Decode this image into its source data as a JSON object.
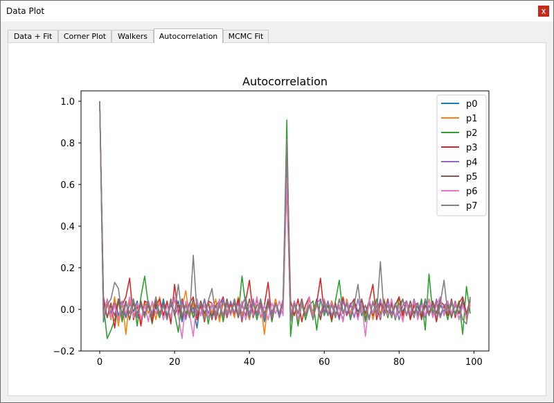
{
  "window": {
    "title": "Data Plot",
    "close_glyph": "x",
    "close_icon": "close-icon"
  },
  "tabs": [
    {
      "label": "Data + Fit",
      "active": false
    },
    {
      "label": "Corner Plot",
      "active": false
    },
    {
      "label": "Walkers",
      "active": false
    },
    {
      "label": "Autocorrelation",
      "active": true
    },
    {
      "label": "MCMC Fit",
      "active": false
    }
  ],
  "chart_data": {
    "type": "line",
    "title": "Autocorrelation",
    "xlabel": "",
    "ylabel": "",
    "xlim": [
      -5,
      104
    ],
    "ylim": [
      -0.2,
      1.05
    ],
    "xticks": [
      0,
      20,
      40,
      60,
      80,
      100
    ],
    "yticks": [
      -0.2,
      0.0,
      0.2,
      0.4,
      0.6,
      0.8,
      1.0
    ],
    "xtick_labels": [
      "0",
      "20",
      "40",
      "60",
      "80",
      "100"
    ],
    "ytick_labels": [
      "−0.2",
      "0.0",
      "0.2",
      "0.4",
      "0.6",
      "0.8",
      "1.0"
    ],
    "grid": false,
    "legend_position": "top-right",
    "series": [
      {
        "name": "p0",
        "color": "#1f77b4",
        "values": [
          1.0,
          -0.06,
          0.04,
          -0.02,
          0.05,
          -0.03,
          0.02,
          -0.04,
          0.03,
          -0.01,
          0.04,
          -0.05,
          0.02,
          0.03,
          -0.02,
          0.01,
          -0.04,
          0.05,
          -0.03,
          0.02,
          -0.01,
          0.04,
          -0.06,
          0.03,
          -0.02,
          0.01,
          -0.09,
          0.04,
          -0.02,
          0.03,
          -0.03,
          0.02,
          -0.04,
          0.05,
          -0.01,
          0.02,
          -0.03,
          0.04,
          -0.02,
          0.01,
          -0.04,
          0.03,
          -0.02,
          0.05,
          -0.06,
          0.02,
          -0.01,
          0.03,
          -0.02,
          0.04,
          0.72,
          -0.05,
          0.03,
          -0.02,
          0.04,
          -0.03,
          0.02,
          -0.01,
          0.05,
          -0.04,
          0.02,
          -0.03,
          0.04,
          -0.02,
          0.01,
          -0.05,
          0.03,
          -0.02,
          0.04,
          -0.01,
          0.02,
          -0.04,
          0.03,
          -0.02,
          0.05,
          -0.03,
          0.01,
          -0.02,
          0.04,
          -0.05,
          0.02,
          -0.01,
          0.03,
          -0.04,
          0.02,
          0.01,
          -0.03,
          0.04,
          -0.02,
          0.03,
          -0.05,
          0.02,
          -0.01,
          0.04,
          -0.03,
          0.02,
          -0.02,
          0.03,
          -0.04,
          0.05
        ]
      },
      {
        "name": "p1",
        "color": "#ff7f0e",
        "values": [
          1.0,
          -0.02,
          0.03,
          -0.05,
          0.06,
          -0.08,
          0.04,
          -0.12,
          0.05,
          -0.03,
          0.02,
          -0.06,
          0.04,
          -0.02,
          0.03,
          -0.05,
          0.06,
          -0.03,
          0.02,
          -0.04,
          0.05,
          -0.02,
          0.01,
          0.09,
          -0.04,
          0.03,
          -0.05,
          0.02,
          -0.03,
          0.04,
          -0.02,
          0.05,
          -0.06,
          0.03,
          -0.01,
          0.02,
          -0.04,
          0.06,
          -0.03,
          0.02,
          -0.05,
          0.04,
          -0.02,
          0.03,
          -0.12,
          0.04,
          -0.02,
          0.05,
          -0.03,
          0.02,
          0.65,
          -0.04,
          0.03,
          -0.06,
          0.02,
          -0.03,
          0.05,
          -0.02,
          0.04,
          -0.05,
          0.03,
          -0.02,
          0.04,
          -0.03,
          0.02,
          -0.06,
          0.05,
          -0.02,
          0.03,
          -0.04,
          0.02,
          -0.03,
          0.04,
          -0.05,
          0.03,
          -0.02,
          0.05,
          -0.03,
          0.02,
          -0.04,
          0.03,
          -0.05,
          0.04,
          -0.02,
          0.03,
          -0.04,
          0.02,
          -0.03,
          0.05,
          -0.02,
          0.03,
          -0.04,
          0.02,
          0.01,
          -0.03,
          0.04,
          -0.02,
          0.03,
          -0.05,
          0.02
        ]
      },
      {
        "name": "p2",
        "color": "#2ca02c",
        "values": [
          1.0,
          0.02,
          -0.14,
          -0.1,
          -0.05,
          0.04,
          -0.06,
          0.03,
          -0.02,
          0.05,
          -0.08,
          0.06,
          0.16,
          0.02,
          -0.07,
          0.03,
          -0.04,
          0.02,
          -0.05,
          0.04,
          -0.02,
          -0.11,
          0.05,
          -0.02,
          0.03,
          -0.04,
          0.02,
          -0.03,
          0.05,
          -0.07,
          0.03,
          -0.02,
          0.04,
          -0.06,
          0.03,
          -0.02,
          0.05,
          -0.03,
          0.16,
          0.02,
          -0.04,
          0.03,
          -0.05,
          0.02,
          -0.03,
          0.05,
          -0.06,
          0.03,
          -0.02,
          0.04,
          0.91,
          -0.13,
          0.04,
          -0.08,
          0.03,
          -0.05,
          0.02,
          0.04,
          -0.1,
          0.05,
          -0.03,
          0.02,
          -0.06,
          0.04,
          0.14,
          -0.02,
          0.03,
          -0.05,
          0.02,
          -0.03,
          0.04,
          -0.06,
          0.03,
          -0.02,
          0.05,
          -0.03,
          0.02,
          -0.04,
          0.03,
          -0.05,
          0.06,
          -0.02,
          0.03,
          -0.04,
          0.02,
          -0.03,
          0.05,
          -0.1,
          0.17,
          -0.02,
          0.04,
          -0.03,
          0.02,
          -0.05,
          0.03,
          -0.02,
          0.04,
          -0.12,
          0.11,
          -0.02
        ]
      },
      {
        "name": "p3",
        "color": "#d62728",
        "values": [
          1.0,
          0.06,
          -0.04,
          0.03,
          -0.09,
          0.05,
          0.02,
          0.06,
          0.15,
          -0.05,
          0.02,
          -0.08,
          0.04,
          0.03,
          -0.06,
          0.02,
          0.05,
          -0.03,
          0.04,
          -0.07,
          0.12,
          -0.02,
          0.05,
          -0.04,
          0.03,
          0.06,
          -0.05,
          0.02,
          -0.06,
          0.04,
          0.03,
          -0.05,
          0.02,
          0.06,
          -0.04,
          0.03,
          -0.02,
          0.05,
          -0.06,
          0.04,
          0.14,
          -0.03,
          0.05,
          -0.04,
          0.02,
          0.13,
          -0.05,
          0.03,
          -0.02,
          0.04,
          0.8,
          0.04,
          -0.03,
          0.05,
          -0.06,
          0.02,
          0.06,
          -0.04,
          0.03,
          0.15,
          -0.02,
          0.04,
          -0.05,
          0.03,
          -0.04,
          0.06,
          -0.03,
          0.02,
          0.05,
          -0.04,
          0.03,
          -0.02,
          0.04,
          0.12,
          -0.05,
          0.03,
          -0.02,
          0.05,
          -0.04,
          0.02,
          0.06,
          -0.03,
          0.04,
          -0.05,
          0.02,
          0.03,
          -0.04,
          0.05,
          -0.02,
          0.03,
          -0.06,
          0.04,
          0.02,
          -0.03,
          0.05,
          -0.04,
          0.03,
          0.06,
          -0.02,
          0.05
        ]
      },
      {
        "name": "p4",
        "color": "#9467bd",
        "values": [
          1.0,
          -0.04,
          0.05,
          -0.02,
          0.03,
          -0.05,
          0.04,
          -0.03,
          0.02,
          0.05,
          -0.04,
          0.03,
          -0.02,
          0.04,
          -0.03,
          0.05,
          -0.02,
          0.03,
          -0.04,
          0.02,
          0.05,
          -0.03,
          0.04,
          -0.05,
          0.03,
          -0.02,
          0.04,
          -0.03,
          0.05,
          -0.02,
          0.03,
          -0.04,
          0.02,
          0.05,
          -0.03,
          0.04,
          -0.02,
          0.03,
          -0.05,
          0.04,
          -0.02,
          0.05,
          -0.03,
          0.02,
          -0.04,
          0.05,
          -0.02,
          0.03,
          -0.04,
          0.02,
          0.68,
          -0.03,
          0.04,
          -0.02,
          0.05,
          -0.03,
          0.02,
          -0.04,
          0.03,
          0.05,
          -0.02,
          0.04,
          -0.03,
          0.02,
          -0.05,
          0.04,
          -0.02,
          0.03,
          -0.04,
          0.05,
          -0.03,
          0.02,
          -0.04,
          0.03,
          -0.02,
          0.05,
          -0.03,
          0.04,
          -0.02,
          0.03,
          -0.05,
          0.02,
          0.04,
          -0.03,
          0.05,
          -0.02,
          0.03,
          -0.04,
          0.02,
          -0.03,
          0.05,
          -0.04,
          0.02,
          0.03,
          -0.02,
          0.04,
          -0.05,
          0.03,
          -0.02,
          0.04
        ]
      },
      {
        "name": "p5",
        "color": "#8c564b",
        "values": [
          1.0,
          0.03,
          -0.04,
          0.02,
          -0.03,
          0.05,
          -0.02,
          0.04,
          -0.05,
          0.03,
          -0.02,
          0.04,
          -0.03,
          0.02,
          -0.05,
          0.04,
          -0.02,
          0.03,
          -0.04,
          0.05,
          -0.03,
          0.02,
          -0.04,
          0.03,
          -0.02,
          0.05,
          -0.03,
          0.04,
          -0.02,
          0.03,
          -0.05,
          0.02,
          0.04,
          -0.03,
          0.05,
          -0.02,
          0.03,
          -0.04,
          0.02,
          -0.03,
          0.05,
          -0.04,
          0.02,
          0.03,
          -0.02,
          0.04,
          -0.05,
          0.03,
          -0.02,
          0.04,
          0.6,
          -0.04,
          0.03,
          -0.02,
          0.05,
          -0.03,
          0.02,
          -0.04,
          0.03,
          -0.05,
          0.04,
          -0.02,
          0.03,
          -0.04,
          0.05,
          -0.02,
          0.03,
          -0.04,
          0.02,
          -0.03,
          0.05,
          -0.02,
          0.04,
          -0.03,
          0.02,
          -0.05,
          0.04,
          -0.02,
          0.03,
          -0.04,
          0.02,
          0.05,
          -0.03,
          0.04,
          -0.02,
          0.03,
          -0.05,
          0.02,
          -0.03,
          0.04,
          -0.02,
          0.05,
          -0.03,
          0.02,
          -0.04,
          0.03,
          -0.02,
          0.05,
          -0.03,
          0.04
        ]
      },
      {
        "name": "p6",
        "color": "#e377c2",
        "values": [
          1.0,
          -0.03,
          0.05,
          -0.04,
          0.02,
          -0.05,
          0.03,
          -0.02,
          0.06,
          -0.04,
          0.03,
          -0.05,
          0.02,
          -0.06,
          0.04,
          -0.02,
          0.03,
          -0.05,
          0.02,
          -0.04,
          0.06,
          -0.03,
          -0.14,
          0.04,
          -0.02,
          -0.13,
          0.05,
          -0.03,
          0.02,
          -0.04,
          0.03,
          -0.02,
          0.05,
          -0.04,
          0.02,
          -0.03,
          0.05,
          -0.02,
          0.04,
          -0.05,
          0.02,
          -0.03,
          0.06,
          -0.04,
          0.02,
          -0.05,
          0.03,
          -0.02,
          0.04,
          -0.03,
          0.63,
          -0.02,
          0.04,
          -0.05,
          0.03,
          -0.02,
          0.06,
          -0.04,
          0.02,
          -0.03,
          0.05,
          -0.02,
          0.03,
          -0.04,
          0.02,
          -0.06,
          0.04,
          -0.03,
          0.02,
          -0.05,
          0.03,
          -0.13,
          0.05,
          -0.02,
          0.03,
          -0.04,
          0.02,
          -0.03,
          0.05,
          -0.04,
          0.02,
          -0.06,
          0.03,
          -0.02,
          0.04,
          -0.05,
          0.02,
          -0.03,
          0.05,
          -0.04,
          0.02,
          0.06,
          -0.03,
          0.04,
          -0.02,
          0.03,
          -0.05,
          0.02,
          -0.04,
          0.03
        ]
      },
      {
        "name": "p7",
        "color": "#7f7f7f",
        "values": [
          1.0,
          -0.05,
          0.02,
          0.05,
          0.13,
          0.1,
          -0.04,
          0.03,
          -0.02,
          0.05,
          -0.03,
          0.02,
          -0.04,
          0.03,
          -0.02,
          0.06,
          -0.03,
          0.02,
          -0.05,
          0.04,
          -0.02,
          0.12,
          -0.03,
          0.02,
          -0.04,
          0.26,
          -0.02,
          0.03,
          -0.05,
          0.04,
          0.1,
          -0.03,
          0.02,
          -0.04,
          0.03,
          -0.02,
          0.05,
          -0.03,
          0.02,
          0.06,
          -0.04,
          0.03,
          -0.02,
          0.05,
          -0.03,
          0.02,
          -0.04,
          0.03,
          -0.02,
          0.05,
          0.82,
          -0.06,
          0.03,
          -0.02,
          0.04,
          -0.03,
          0.02,
          -0.05,
          0.03,
          -0.02,
          0.04,
          -0.03,
          0.02,
          -0.04,
          0.05,
          -0.02,
          0.03,
          -0.04,
          0.02,
          0.12,
          -0.03,
          0.02,
          -0.05,
          0.04,
          -0.02,
          0.23,
          -0.03,
          0.02,
          -0.04,
          0.03,
          -0.02,
          0.05,
          -0.03,
          0.02,
          -0.04,
          0.03,
          -0.02,
          0.05,
          -0.03,
          0.02,
          -0.04,
          0.03,
          0.14,
          -0.02,
          0.04,
          -0.03,
          0.02,
          -0.05,
          -0.07,
          0.06
        ]
      }
    ]
  }
}
